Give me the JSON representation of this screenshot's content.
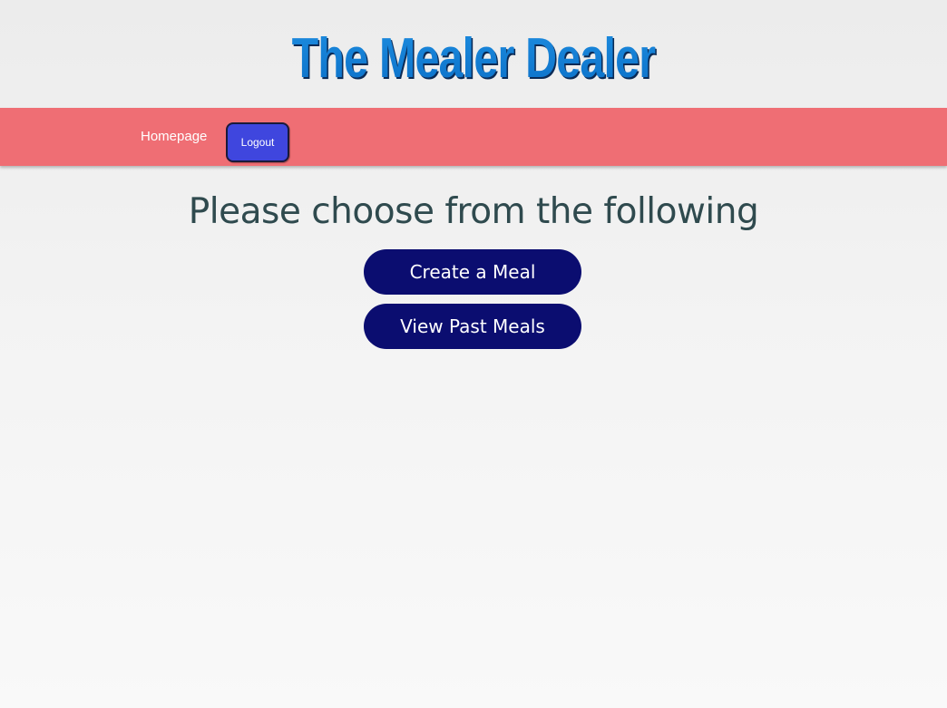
{
  "header": {
    "title": "The Mealer Dealer"
  },
  "nav": {
    "homepage_label": "Homepage",
    "logout_label": "Logout"
  },
  "main": {
    "prompt": "Please choose from the following",
    "create_meal_label": "Create a Meal",
    "view_past_meals_label": "View Past Meals"
  },
  "colors": {
    "navbar_bg": "#ef6e74",
    "logout_bg": "#3f46de",
    "action_button_bg": "#0b0d70",
    "title_blue": "#0f7fd6",
    "prompt_text": "#2f4a4e"
  }
}
